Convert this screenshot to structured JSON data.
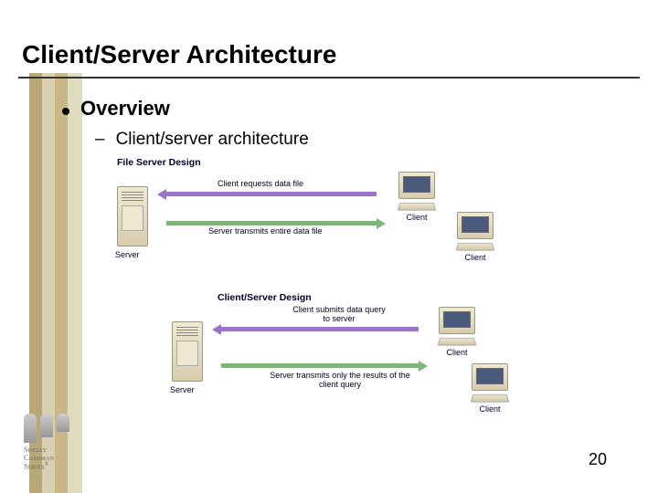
{
  "title": "Client/Server Architecture",
  "bullet": {
    "text": "Overview"
  },
  "sub": {
    "text": "Client/server architecture"
  },
  "diagram1": {
    "title": "File Server Design",
    "server_label": "Server",
    "arrow_top": "Client requests data file",
    "arrow_bottom": "Server transmits entire data file",
    "client_label": "Client"
  },
  "diagram2": {
    "title": "Client/Server Design",
    "server_label": "Server",
    "arrow_top": "Client submits data query to server",
    "arrow_bottom": "Server transmits only the results of the client query",
    "client_label": "Client"
  },
  "logo": {
    "line1": "Shelly",
    "line2": "Cashman",
    "line3": "Series"
  },
  "page_number": "20"
}
